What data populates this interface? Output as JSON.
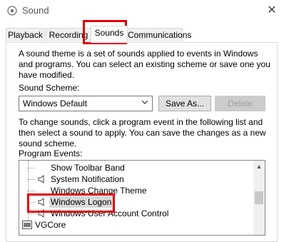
{
  "window": {
    "title": "Sound",
    "close_glyph": "✕"
  },
  "tabs": [
    {
      "label": "Playback"
    },
    {
      "label": "Recording"
    },
    {
      "label": "Sounds"
    },
    {
      "label": "Communications"
    }
  ],
  "intro_text_1": "A sound theme is a set of sounds applied to events in Windows",
  "intro_text_2": "and programs.  You can select an existing scheme or save one you",
  "intro_text_3": "have modified.",
  "scheme": {
    "label": "Sound Scheme:",
    "value": "Windows Default",
    "save_label": "Save As...",
    "delete_label": "Delete"
  },
  "instr_text_1": "To change sounds, click a program event in the following list and",
  "instr_text_2": "then select a sound to apply.  You can save the changes as a new",
  "instr_text_3": "sound scheme.",
  "program_events_label": "Program Events:",
  "events": [
    {
      "label": "Show Toolbar Band",
      "has_sound": false
    },
    {
      "label": "System Notification",
      "has_sound": true
    },
    {
      "label": "Windows Change Theme",
      "has_sound": false
    },
    {
      "label": "Windows Logon",
      "has_sound": true,
      "selected": true
    },
    {
      "label": "Windows User Account Control",
      "has_sound": true
    },
    {
      "label": "VGCore",
      "is_group": true
    }
  ],
  "colors": {
    "highlight": "#e00000",
    "accent": "#0078d7"
  }
}
